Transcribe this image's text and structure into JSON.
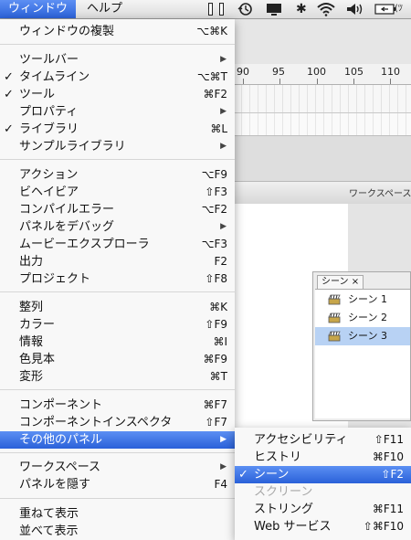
{
  "menubar": {
    "window_label": "ウィンドウ",
    "help_label": "ヘルプ",
    "right_text": "(ﾂ"
  },
  "timeline": {
    "ruler_numbers": [
      "90",
      "95",
      "100",
      "105",
      "110"
    ]
  },
  "workspace_label": "ワークスペース",
  "scene_panel": {
    "tab_label": "シーン",
    "close_glyph": "×",
    "scenes": [
      "シーン 1",
      "シーン 2",
      "シーン 3"
    ],
    "selected_index": 2
  },
  "window_menu": {
    "items": [
      {
        "label": "ウィンドウの複製",
        "shortcut": "⌥⌘K"
      },
      {
        "label": "ツールバー",
        "arrow": true
      },
      {
        "label": "タイムライン",
        "shortcut": "⌥⌘T",
        "checked": true
      },
      {
        "label": "ツール",
        "shortcut": "⌘F2",
        "checked": true
      },
      {
        "label": "プロパティ",
        "arrow": true
      },
      {
        "label": "ライブラリ",
        "shortcut": "⌘L",
        "checked": true
      },
      {
        "label": "サンプルライブラリ",
        "arrow": true
      },
      {
        "label": "アクション",
        "shortcut": "⌥F9"
      },
      {
        "label": "ビヘイビア",
        "shortcut": "⇧F3"
      },
      {
        "label": "コンパイルエラー",
        "shortcut": "⌥F2"
      },
      {
        "label": "パネルをデバッグ",
        "arrow": true
      },
      {
        "label": "ムービーエクスプローラ",
        "shortcut": "⌥F3"
      },
      {
        "label": "出力",
        "shortcut": "F2"
      },
      {
        "label": "プロジェクト",
        "shortcut": "⇧F8"
      },
      {
        "label": "整列",
        "shortcut": "⌘K"
      },
      {
        "label": "カラー",
        "shortcut": "⇧F9"
      },
      {
        "label": "情報",
        "shortcut": "⌘I"
      },
      {
        "label": "色見本",
        "shortcut": "⌘F9"
      },
      {
        "label": "変形",
        "shortcut": "⌘T"
      },
      {
        "label": "コンポーネント",
        "shortcut": "⌘F7"
      },
      {
        "label": "コンポーネントインスペクタ",
        "shortcut": "⇧F7"
      },
      {
        "label": "その他のパネル",
        "arrow": true,
        "highlighted": true
      },
      {
        "label": "ワークスペース",
        "arrow": true
      },
      {
        "label": "パネルを隠す",
        "shortcut": "F4"
      },
      {
        "label": "重ねて表示"
      },
      {
        "label": "並べて表示"
      }
    ]
  },
  "other_panels_menu": {
    "items": [
      {
        "label": "アクセシビリティ",
        "shortcut": "⇧F11"
      },
      {
        "label": "ヒストリ",
        "shortcut": "⌘F10"
      },
      {
        "label": "シーン",
        "shortcut": "⇧F2",
        "checked": true,
        "highlighted": true
      },
      {
        "label": "スクリーン",
        "disabled": true
      },
      {
        "label": "ストリング",
        "shortcut": "⌘F11"
      },
      {
        "label": "Web サービス",
        "shortcut": "⇧⌘F10"
      }
    ]
  },
  "check_glyph": "✓",
  "arrow_glyph": "▶",
  "colors": {
    "highlight": "#2a61d9",
    "selected_scene": "#b8d2f4"
  }
}
